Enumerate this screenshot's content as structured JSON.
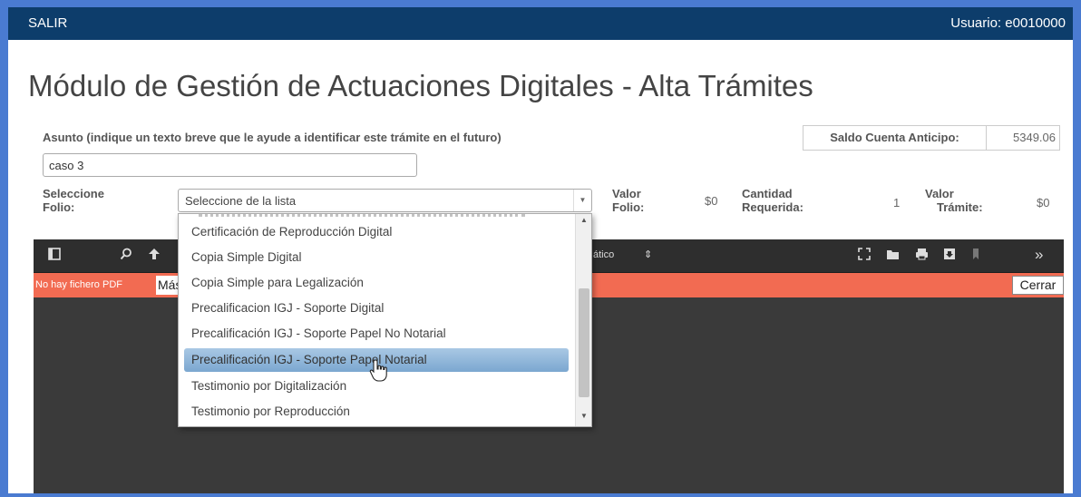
{
  "header": {
    "salir_label": "SALIR",
    "usuario_label": "Usuario: e0010000"
  },
  "page_title": "Módulo de Gestión de Actuaciones Digitales - Alta Trámites",
  "asunto": {
    "label": "Asunto (indique un texto breve que le ayude a identificar este trámite en el futuro)",
    "value": "caso 3"
  },
  "saldo": {
    "label": "Saldo Cuenta Anticipo:",
    "value": "5349.06"
  },
  "folio": {
    "label_line1": "Seleccione",
    "label_line2": "Folio:",
    "select_value": "Seleccione de la lista",
    "valor_folio_label_1": "Valor",
    "valor_folio_label_2": "Folio:",
    "valor_folio_value": "$0",
    "cantidad_label_1": "Cantidad",
    "cantidad_label_2": "Requerida:",
    "cantidad_value": "1",
    "valor_tramite_label_1": "Valor",
    "valor_tramite_label_2": "Trámite:",
    "valor_tramite_value": "$0"
  },
  "dropdown": {
    "options": [
      "Certificación de Reproducción Digital",
      "Copia Simple Digital",
      "Copia Simple para Legalización",
      "Precalificacion IGJ - Soporte Digital",
      "Precalificación IGJ - Soporte Papel No Notarial",
      "Precalificación IGJ - Soporte Papel Notarial",
      "Testimonio por Digitalización",
      "Testimonio por Reproducción"
    ],
    "highlighted_index": 5
  },
  "viewer": {
    "zoom_label": "ático",
    "error_message": "No hay fichero PDF",
    "more_info_label": "Más información",
    "close_label": "Cerrar"
  },
  "icons": {
    "sidebar_toggle": "sidebar-toggle-icon",
    "search": "search-icon",
    "previous": "arrow-up-icon",
    "fullscreen": "fullscreen-icon",
    "open": "open-file-icon",
    "print": "print-icon",
    "download": "download-icon",
    "bookmark": "bookmark-icon",
    "more": "double-chevron-right-icon"
  },
  "colors": {
    "topbar": "#0d3d6b",
    "error_bar": "#f26b52",
    "viewer_bg": "#3a3a3a",
    "frame_border": "#4a7bd1"
  }
}
